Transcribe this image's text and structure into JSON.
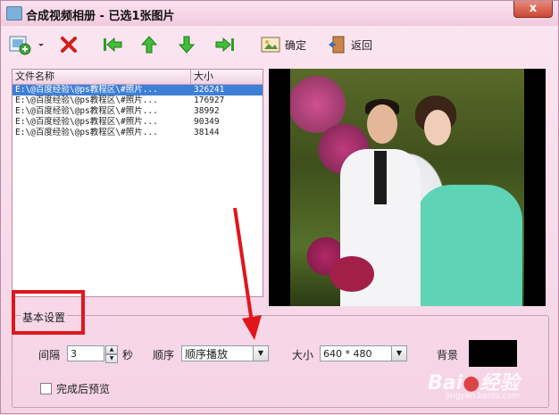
{
  "window": {
    "title": "合成视频相册 - 已选1张图片",
    "close_glyph": "x"
  },
  "toolbar": {
    "buttons": [
      {
        "icon": "add-image-icon",
        "label": ""
      },
      {
        "icon": "dropdown-arrow-icon",
        "label": ""
      },
      {
        "icon": "delete-icon",
        "label": ""
      },
      {
        "icon": "move-first-icon",
        "label": ""
      },
      {
        "icon": "move-up-icon",
        "label": ""
      },
      {
        "icon": "move-down-icon",
        "label": ""
      },
      {
        "icon": "move-last-icon",
        "label": ""
      }
    ],
    "confirm_label": "确定",
    "back_label": "返回"
  },
  "file_list": {
    "columns": [
      "文件名称",
      "大小"
    ],
    "rows": [
      {
        "name": "E:\\@百度经验\\@ps教程区\\#照片...",
        "size": "326241",
        "selected": true
      },
      {
        "name": "E:\\@百度经验\\@ps教程区\\#照片...",
        "size": "176927",
        "selected": false
      },
      {
        "name": "E:\\@百度经验\\@ps教程区\\#照片...",
        "size": "38992",
        "selected": false
      },
      {
        "name": "E:\\@百度经验\\@ps教程区\\#照片...",
        "size": "90349",
        "selected": false
      },
      {
        "name": "E:\\@百度经验\\@ps教程区\\#照片...",
        "size": "38144",
        "selected": false
      }
    ]
  },
  "settings": {
    "group_label": "基本设置",
    "interval_label": "间隔",
    "interval_value": "3",
    "interval_unit": "秒",
    "order_label": "顺序",
    "order_value": "顺序播放",
    "size_label": "大小",
    "size_value": "640 * 480",
    "background_label": "背景",
    "background_color": "#000000",
    "preview_after_label": "完成后预览",
    "preview_after_checked": false
  },
  "annotation_color": "#e0161b",
  "watermark": {
    "text": "Bai 经验",
    "sub": "jingyan.baidu.com"
  }
}
